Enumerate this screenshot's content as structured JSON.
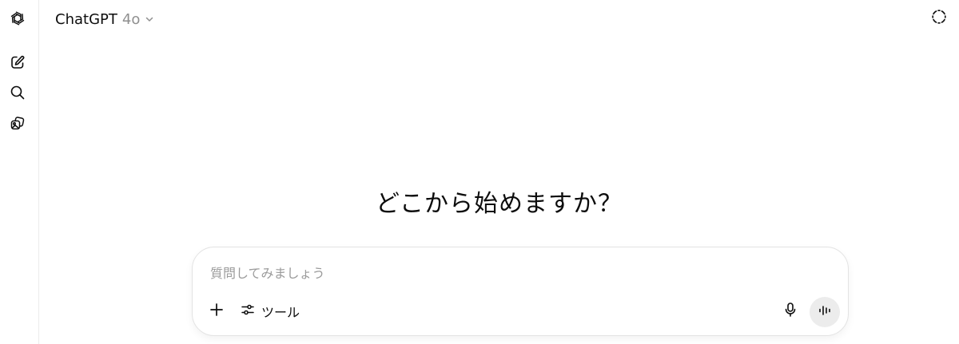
{
  "header": {
    "model_name": "ChatGPT",
    "model_version": "4o"
  },
  "sidebar": {
    "items": [
      {
        "icon": "openai-logo-icon"
      },
      {
        "icon": "new-chat-icon"
      },
      {
        "icon": "search-icon"
      },
      {
        "icon": "library-icon"
      }
    ]
  },
  "main": {
    "hero_text": "どこから始めますか？"
  },
  "composer": {
    "placeholder": "質問してみましょう",
    "value": "",
    "tools_label": "ツール"
  },
  "colors": {
    "text": "#0d0d0d",
    "muted": "#8f8f8f",
    "border": "#e3e3e3",
    "voice_button_bg": "#ececec"
  }
}
